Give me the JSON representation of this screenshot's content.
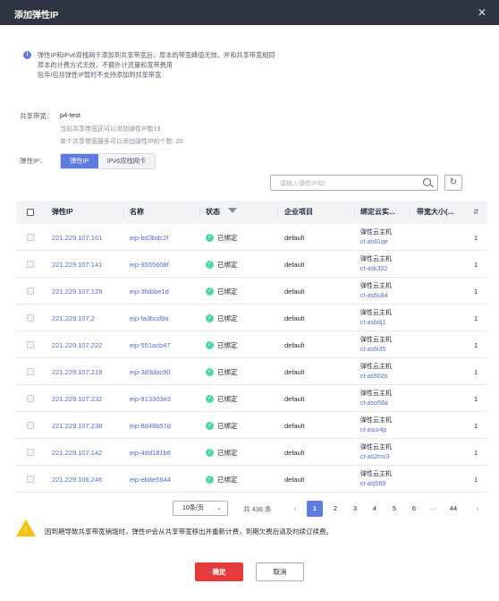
{
  "dialog": {
    "title": "添加弹性IP",
    "close_symbol": "✕"
  },
  "notice": {
    "icon": "info-icon",
    "lines": [
      "弹性IP和IPv6双栈网卡添加到共享带宽后，原本的带宽峰值无效，并和共享带宽相同",
      "原本的计费方式无效，不额外计流量和宽带费用",
      "包年/包月弹性IP暂时不支持添加到共享带宽"
    ]
  },
  "shared_bandwidth": {
    "label": "共享带宽：",
    "value": "p4-test",
    "hint1": "当前共享带宽还可以添加弹性IP数19",
    "hint2": "单个共享带宽最多可以添加弹性IP的个数: 20"
  },
  "eip_type": {
    "label": "弹性IP：",
    "options": [
      "弹性IP",
      "IPv6双栈网卡"
    ],
    "selected": "弹性IP"
  },
  "search": {
    "placeholder": "请输入弹性IP/ID"
  },
  "table": {
    "columns": [
      "弹性IP",
      "名称",
      "状态",
      "企业项目",
      "绑定云实...",
      "带宽大小(..."
    ],
    "rows": [
      {
        "ip": "221.229.107.161",
        "name": "eip-bd3bdc2f",
        "status": "已绑定",
        "project": "default",
        "bind_type": "弹性云主机",
        "bind_id": "ct-as81qe",
        "bw": "1"
      },
      {
        "ip": "221.229.107.141",
        "name": "eip-9555608f",
        "status": "已绑定",
        "project": "default",
        "bind_type": "弹性云主机",
        "bind_id": "ct-ask302",
        "bw": "1"
      },
      {
        "ip": "221.229.107.129",
        "name": "eip-3fabbe1d",
        "status": "已绑定",
        "project": "default",
        "bind_type": "弹性云主机",
        "bind_id": "ct-as6u84",
        "bw": "1"
      },
      {
        "ip": "221.229.107.2",
        "name": "eip-fa3bcd9a",
        "status": "已绑定",
        "project": "default",
        "bind_type": "弹性云主机",
        "bind_id": "ct-asbdj1",
        "bw": "1"
      },
      {
        "ip": "221.229.107.222",
        "name": "eip-551acb47",
        "status": "已绑定",
        "project": "default",
        "bind_type": "弹性云主机",
        "bind_id": "ct-as6i35",
        "bw": "1"
      },
      {
        "ip": "221.229.107.219",
        "name": "eip-3d3dac90",
        "status": "已绑定",
        "project": "default",
        "bind_type": "弹性云主机",
        "bind_id": "ct-as60zo",
        "bw": "1"
      },
      {
        "ip": "221.229.107.232",
        "name": "eip-913303e3",
        "status": "已绑定",
        "project": "default",
        "bind_type": "弹性云主机",
        "bind_id": "ct-aso58a",
        "bw": "1"
      },
      {
        "ip": "221.229.107.238",
        "name": "eip-8d48b57d",
        "status": "已绑定",
        "project": "default",
        "bind_type": "弹性云主机",
        "bind_id": "ct-asur4p",
        "bw": "1"
      },
      {
        "ip": "221.229.107.142",
        "name": "eip-4dd181b8",
        "status": "已绑定",
        "project": "default",
        "bind_type": "弹性云主机",
        "bind_id": "ct-as2mv3",
        "bw": "1"
      },
      {
        "ip": "221.229.106.246",
        "name": "eip-eb8e5644",
        "status": "已绑定",
        "project": "default",
        "bind_type": "弹性云主机",
        "bind_id": "ct-asj569",
        "bw": "1"
      }
    ]
  },
  "pagination": {
    "page_size": "10条/页",
    "total": "共 436 条",
    "pages": [
      "1",
      "2",
      "3",
      "4",
      "5",
      "6",
      "···",
      "44"
    ],
    "current": "1",
    "prev": "‹",
    "next": "›"
  },
  "warning": {
    "icon": "warning-icon",
    "text": "因到期导致共享带宽销毁时，弹性IP会从共享带宽移出并重新计费，到期欠费后请及时续订续费。"
  },
  "buttons": {
    "ok": "确定",
    "cancel": "取消"
  },
  "colors": {
    "header_bg": "#2e3440",
    "accent": "#5e7ce0",
    "link": "#526ecc",
    "ok_button": "#e43c3c",
    "status_ok": "#50d4ab",
    "warning": "#fac20a"
  }
}
